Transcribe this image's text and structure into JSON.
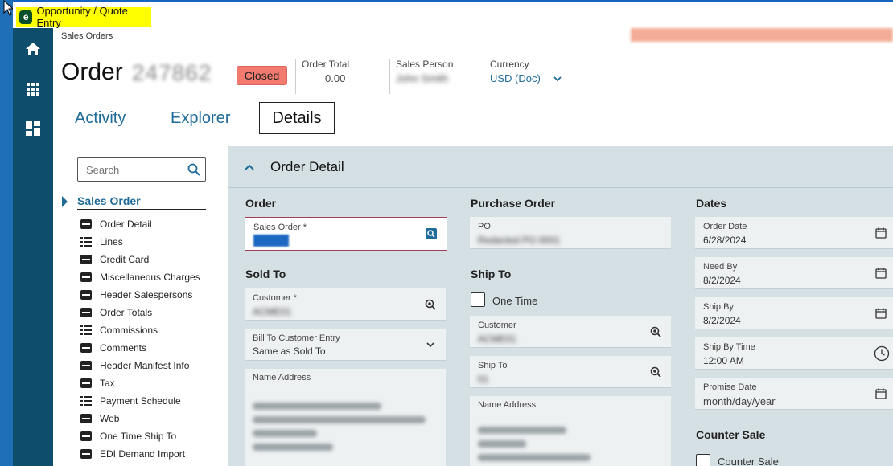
{
  "window": {
    "title": "Opportunity / Quote Entry",
    "logo_letter": "e"
  },
  "breadcrumb": "Sales Orders",
  "order": {
    "title": "Order",
    "number": "247862",
    "status": "Closed",
    "total_label": "Order Total",
    "total_value": "0.00",
    "salesperson_label": "Sales Person",
    "salesperson_value": "John Smith",
    "currency_label": "Currency",
    "currency_value": "USD (Doc)"
  },
  "tabs": [
    {
      "label": "Activity"
    },
    {
      "label": "Explorer"
    },
    {
      "label": "Details"
    }
  ],
  "leftnav": {
    "search_placeholder": "Search",
    "section": "Sales Order",
    "items": [
      {
        "label": "Order Detail",
        "icon": "card-icon"
      },
      {
        "label": "Lines",
        "icon": "list-icon"
      },
      {
        "label": "Credit Card",
        "icon": "card-icon"
      },
      {
        "label": "Miscellaneous Charges",
        "icon": "card-icon"
      },
      {
        "label": "Header Salespersons",
        "icon": "card-icon"
      },
      {
        "label": "Order Totals",
        "icon": "card-icon"
      },
      {
        "label": "Commissions",
        "icon": "list-icon"
      },
      {
        "label": "Comments",
        "icon": "card-icon"
      },
      {
        "label": "Header Manifest Info",
        "icon": "card-icon"
      },
      {
        "label": "Tax",
        "icon": "card-icon"
      },
      {
        "label": "Payment Schedule",
        "icon": "list-icon"
      },
      {
        "label": "Web",
        "icon": "card-icon"
      },
      {
        "label": "One Time Ship To",
        "icon": "card-icon"
      },
      {
        "label": "EDI Demand Import",
        "icon": "card-icon"
      }
    ]
  },
  "detail": {
    "title": "Order Detail",
    "order_col": {
      "heading": "Order",
      "sales_order_label": "Sales Order *",
      "sales_order_value": "247862",
      "sold_to_heading": "Sold To",
      "customer_label": "Customer *",
      "customer_value": "ACME01",
      "bill_to_label": "Bill To Customer Entry",
      "bill_to_value": "Same as Sold To",
      "name_address_label": "Name Address"
    },
    "po_col": {
      "heading": "Purchase Order",
      "po_label": "PO",
      "po_value": "Redacted PO 0001",
      "ship_to_heading": "Ship To",
      "one_time_label": "One Time",
      "customer_label": "Customer",
      "customer_value": "ACME01",
      "ship_to_label": "Ship To",
      "ship_to_value": "01",
      "name_address_label": "Name Address"
    },
    "dates_col": {
      "heading": "Dates",
      "order_date_label": "Order Date",
      "order_date_value": "6/28/2024",
      "need_by_label": "Need By",
      "need_by_value": "8/2/2024",
      "ship_by_label": "Ship By",
      "ship_by_value": "8/2/2024",
      "ship_by_time_label": "Ship By Time",
      "ship_by_time_value": "12:00 AM",
      "promise_date_label": "Promise Date",
      "promise_date_placeholder": "month/day/year",
      "counter_sale_heading": "Counter Sale",
      "counter_sale_label": "Counter Sale"
    }
  },
  "colors": {
    "accent": "#1f6b9a",
    "rail": "#0f4d6c",
    "status_closed": "#f27a6e",
    "panel": "#d5e0e4"
  }
}
